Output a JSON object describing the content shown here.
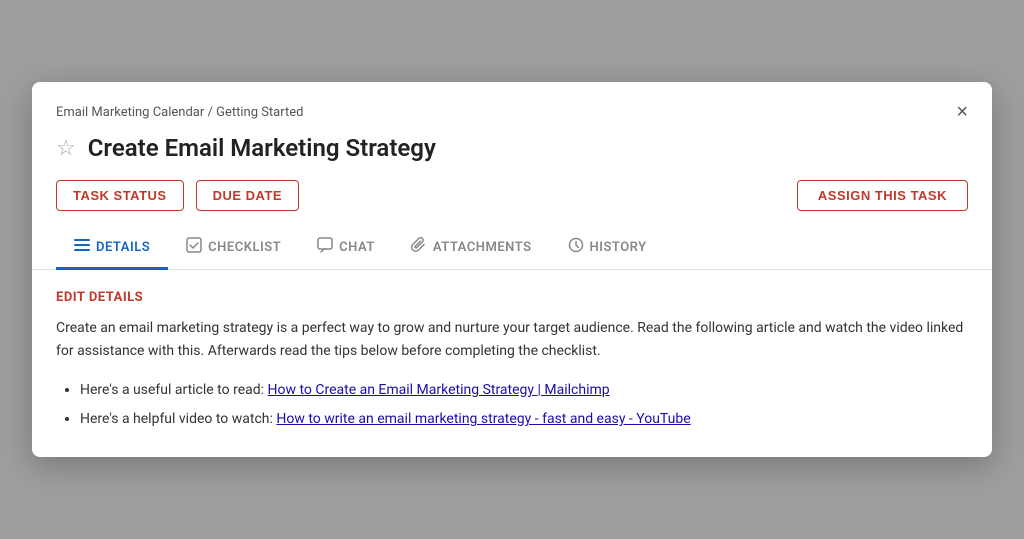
{
  "breadcrumb": {
    "text": "Email Marketing Calendar / Getting Started"
  },
  "close_button_label": "×",
  "title": "Create Email Marketing Strategy",
  "buttons": {
    "task_status": "TASK STATUS",
    "due_date": "DUE DATE",
    "assign": "ASSIGN THIS TASK"
  },
  "tabs": [
    {
      "id": "details",
      "label": "DETAILS",
      "icon": "☰",
      "active": true
    },
    {
      "id": "checklist",
      "label": "CHECKLIST",
      "icon": "☑",
      "active": false
    },
    {
      "id": "chat",
      "label": "CHAT",
      "icon": "💬",
      "active": false
    },
    {
      "id": "attachments",
      "label": "ATTACHMENTS",
      "icon": "📎",
      "active": false
    },
    {
      "id": "history",
      "label": "HISTORY",
      "icon": "🕐",
      "active": false
    }
  ],
  "edit_details_label": "EDIT DETAILS",
  "description": "Create an email marketing strategy is a perfect way to grow and nurture your target audience. Read the following article and watch the video linked for assistance with this. Afterwards read the tips below before completing the checklist.",
  "links": [
    {
      "prefix": "Here's a useful article to read: ",
      "text": "How to Create an Email Marketing Strategy | Mailchimp",
      "url": "#"
    },
    {
      "prefix": "Here's a helpful video to watch: ",
      "text": "How to write an email marketing strategy - fast and easy - YouTube",
      "url": "#"
    }
  ]
}
